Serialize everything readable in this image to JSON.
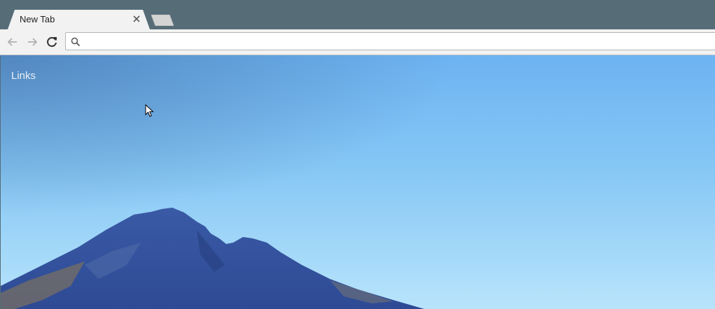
{
  "tab": {
    "title": "New Tab",
    "close_icon": "close-icon"
  },
  "toolbar": {
    "back_icon": "back-arrow-icon",
    "forward_icon": "forward-arrow-icon",
    "reload_icon": "reload-icon",
    "omnibox": {
      "value": "",
      "icon": "search-icon"
    }
  },
  "content": {
    "links_label": "Links"
  },
  "colors": {
    "frame": "#566d78",
    "toolbar": "#f2f2f2",
    "sky_top": "#6db3f2",
    "sky_bottom": "#b8e4fb",
    "mountain": "#3b5fa8"
  }
}
